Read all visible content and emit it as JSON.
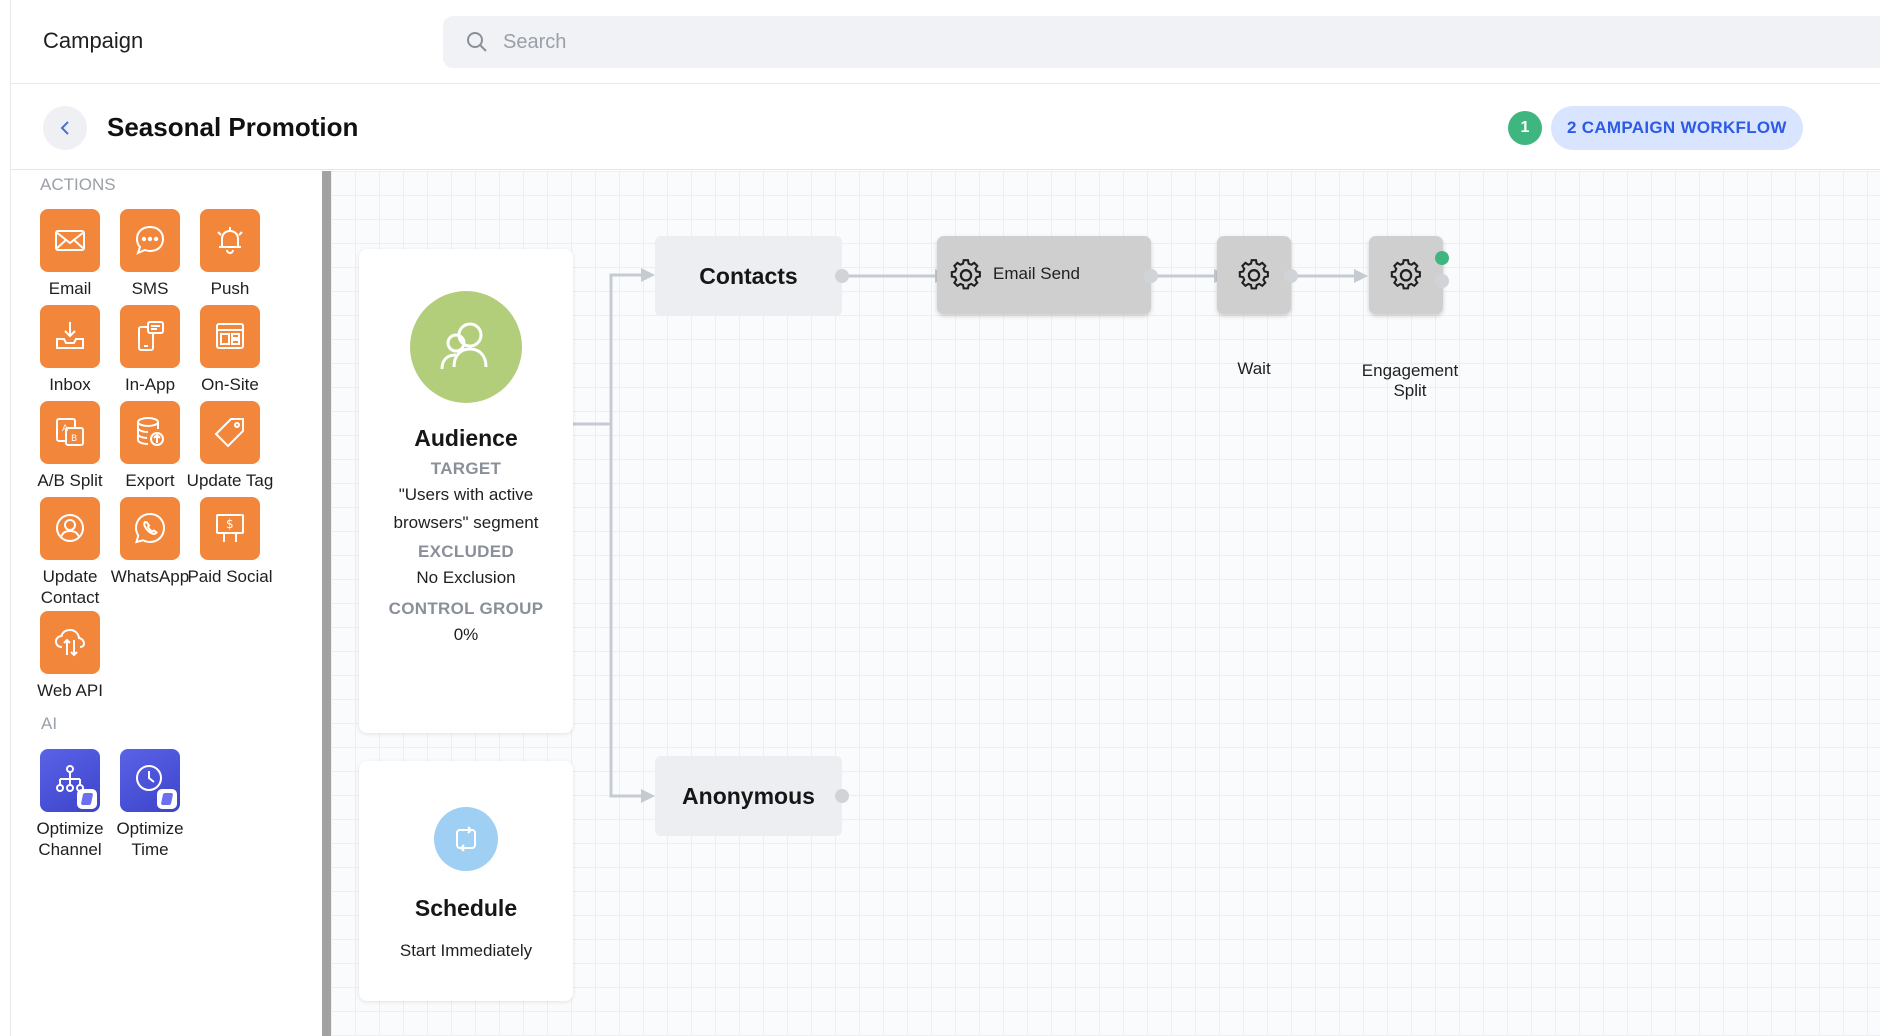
{
  "app": {
    "title": "Campaign"
  },
  "search": {
    "placeholder": "Search"
  },
  "header": {
    "title": "Seasonal Promotion",
    "step_number": "1",
    "workflow_label": "2 CAMPAIGN WORKFLOW",
    "colors": {
      "step_badge": "#3fb57f",
      "workflow_pill_bg": "#d9e4ff",
      "workflow_pill_text": "#2d5be3"
    }
  },
  "sidebar": {
    "actions_heading": "ACTIONS",
    "ai_heading": "AI",
    "action_color": "#f2873b",
    "actions": [
      {
        "label": "Email",
        "icon": "envelope-icon"
      },
      {
        "label": "SMS",
        "icon": "chat-bubble-icon"
      },
      {
        "label": "Push",
        "icon": "bell-icon"
      },
      {
        "label": "Inbox",
        "icon": "inbox-tray-icon"
      },
      {
        "label": "In-App",
        "icon": "phone-message-icon"
      },
      {
        "label": "On-Site",
        "icon": "browser-layout-icon"
      },
      {
        "label": "A/B Split",
        "icon": "ab-split-icon"
      },
      {
        "label": "Export",
        "icon": "database-export-icon"
      },
      {
        "label": "Update Tag",
        "icon": "tag-icon"
      },
      {
        "label": "Update Contact",
        "icon": "user-circle-icon"
      },
      {
        "label": "WhatsApp",
        "icon": "whatsapp-icon"
      },
      {
        "label": "Paid Social",
        "icon": "billboard-dollar-icon"
      },
      {
        "label": "Web API",
        "icon": "cloud-transfer-icon"
      }
    ],
    "ai_actions": [
      {
        "label": "Optimize Channel",
        "icon": "hierarchy-icon"
      },
      {
        "label": "Optimize Time",
        "icon": "clock-icon"
      }
    ]
  },
  "canvas": {
    "audience": {
      "title": "Audience",
      "target_label": "TARGET",
      "target_value": "\"Users with active browsers\" segment",
      "excluded_label": "EXCLUDED",
      "excluded_value": "No Exclusion",
      "control_label": "CONTROL GROUP",
      "control_value": "0%"
    },
    "schedule": {
      "title": "Schedule",
      "value": "Start Immediately"
    },
    "branches": {
      "contacts": "Contacts",
      "anonymous": "Anonymous"
    },
    "nodes": {
      "email_send": "Email Send",
      "wait": "Wait",
      "engagement_split": "Engagement Split"
    }
  }
}
